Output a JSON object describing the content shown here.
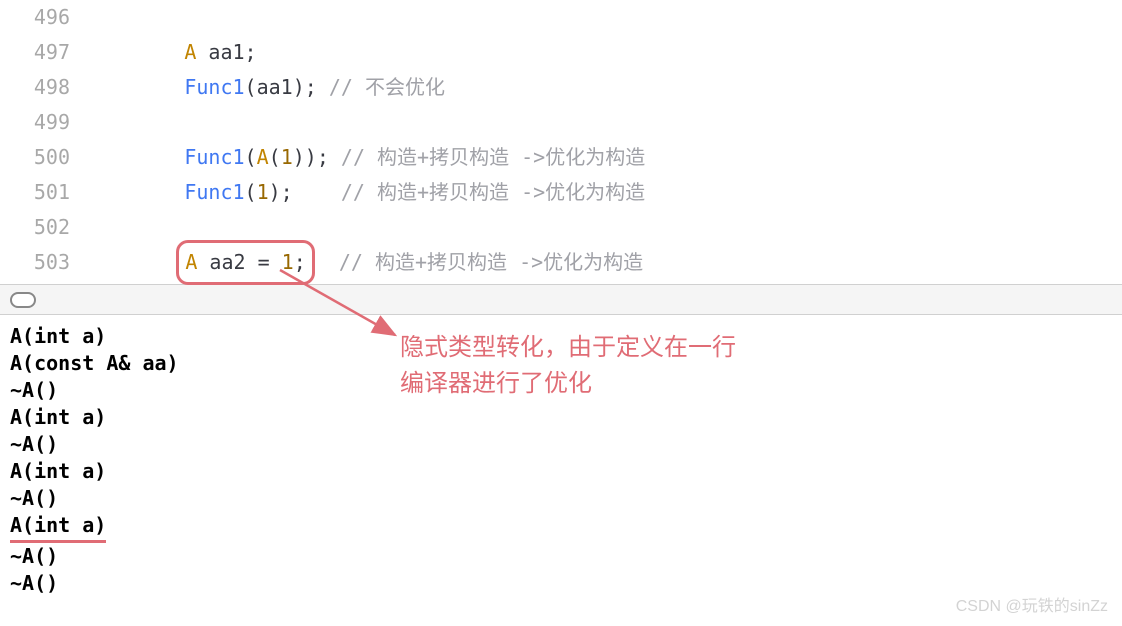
{
  "code": {
    "lines": [
      {
        "num": "496",
        "indent": "",
        "html": ""
      },
      {
        "num": "497",
        "indent": "        ",
        "tokens": [
          {
            "t": "identifier",
            "v": "A"
          },
          {
            "t": "plain",
            "v": " aa1;"
          }
        ]
      },
      {
        "num": "498",
        "indent": "        ",
        "tokens": [
          {
            "t": "function-call",
            "v": "Func1"
          },
          {
            "t": "plain",
            "v": "(aa1); "
          },
          {
            "t": "comment",
            "v": "// 不会优化"
          }
        ]
      },
      {
        "num": "499",
        "indent": "",
        "tokens": []
      },
      {
        "num": "500",
        "indent": "        ",
        "tokens": [
          {
            "t": "function-call",
            "v": "Func1"
          },
          {
            "t": "plain",
            "v": "("
          },
          {
            "t": "identifier",
            "v": "A"
          },
          {
            "t": "plain",
            "v": "("
          },
          {
            "t": "number",
            "v": "1"
          },
          {
            "t": "plain",
            "v": ")); "
          },
          {
            "t": "comment",
            "v": "// 构造+拷贝构造 ->优化为构造"
          }
        ]
      },
      {
        "num": "501",
        "indent": "        ",
        "tokens": [
          {
            "t": "function-call",
            "v": "Func1"
          },
          {
            "t": "plain",
            "v": "("
          },
          {
            "t": "number",
            "v": "1"
          },
          {
            "t": "plain",
            "v": ");    "
          },
          {
            "t": "comment",
            "v": "// 构造+拷贝构造 ->优化为构造"
          }
        ]
      },
      {
        "num": "502",
        "indent": "",
        "tokens": []
      },
      {
        "num": "503",
        "indent": "        ",
        "highlighted": true,
        "tokens": [
          {
            "t": "identifier",
            "v": "A"
          },
          {
            "t": "plain",
            "v": " aa2 = "
          },
          {
            "t": "number",
            "v": "1"
          },
          {
            "t": "plain",
            "v": ";"
          }
        ],
        "after": [
          {
            "t": "plain",
            "v": "  "
          },
          {
            "t": "comment",
            "v": "// 构造+拷贝构造 ->优化为构造"
          }
        ]
      }
    ]
  },
  "output": {
    "lines": [
      {
        "text": "A(int a)"
      },
      {
        "text": "A(const A& aa)"
      },
      {
        "text": "~A()"
      },
      {
        "text": "A(int a)"
      },
      {
        "text": "~A()"
      },
      {
        "text": "A(int a)"
      },
      {
        "text": "~A()"
      },
      {
        "text": "A(int a)",
        "underline": true
      },
      {
        "text": "~A()"
      },
      {
        "text": "~A()"
      }
    ]
  },
  "annotation": {
    "line1": "隐式类型转化，由于定义在一行",
    "line2": "编译器进行了优化"
  },
  "watermark": "CSDN @玩铁的sinZz",
  "colors": {
    "accent_red": "#e06c75"
  }
}
